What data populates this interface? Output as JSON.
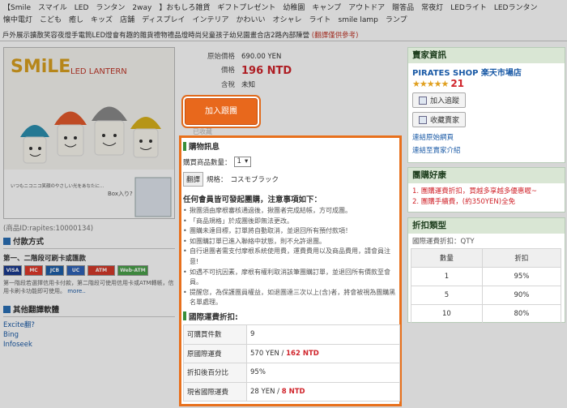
{
  "tags": [
    "【Smile",
    "スマイル",
    "LED",
    "ランタン",
    "2way",
    "】おもしろ雑貨",
    "ギフトプレゼント",
    "幼稚園",
    "キャンプ",
    "アウトドア",
    "贈答品",
    "常夜灯",
    "LEDライト",
    "LEDランタン",
    "懐中電灯",
    "こども",
    "癒し",
    "キッズ",
    "店舗",
    "ディスプレイ",
    "インテリア",
    "かわいい",
    "オシャレ",
    "ライト",
    "smile lamp",
    "ランプ"
  ],
  "title": "戶外展示擴散笑容夜燈手電筒LED燈會有趣的雜貨禮物禮品燈時尚兒童孩子幼兒園畫合店2路內部陳營",
  "title_note": "(翻譯僅供參考)",
  "product_image": {
    "brand": "SMiLE",
    "subtitle": "LED LANTERN",
    "caption": "いつもニコニコ笑顔のやさしい光をあなたに…",
    "box_label": "Box入り?"
  },
  "product_id": "(商品ID:rapites:10000134)",
  "payment": {
    "header": "付款方式",
    "line": "第一、二階段可刷卡或匯款",
    "cards": [
      "VISA",
      "MC",
      "JCB",
      "UC",
      "ATM",
      "Web-ATM"
    ],
    "note": "第一階段若選擇信用卡付款，第二階段可使用信用卡或ATM轉帳，信用卡刷卡功能即可使用。",
    "more": "more.."
  },
  "translator": {
    "header": "其他翻譯軟體",
    "links": [
      "Excite翻?",
      "Bing",
      "Infoseek"
    ]
  },
  "price": {
    "orig_label": "原始價格",
    "orig_value": "690.00 YEN",
    "price_label": "價格",
    "price_value": "196 NTD",
    "tax_label": "含稅",
    "tax_value": "未知"
  },
  "add_to_cart": "加入跟團",
  "added_link": "已收藏",
  "purchase": {
    "header": "購物訊息",
    "qty_label": "購買商品數量：",
    "qty_value": "1",
    "translate_btn": "翻譯",
    "spec_label": "規格：",
    "spec_value": "コスモブラック",
    "notice_title": "任何會員皆可發起團購，注意事項如下：",
    "rules": [
      "揪團須由摩根審核通過後，揪團者完成結帳，方可成團。",
      "「商品規格」於成團後即無法更改。",
      "團購未達目標，訂單將自動取消，並退回所有預付款項！",
      "如團購訂單已進入聯絡中狀態，則不允許退團。",
      "自行退團者需支付摩根系統使用費，運費費用以及商品費用，請會員注意!",
      "如遇不可抗因素，摩根有權利取消該筆團購訂單，並退回所有價款至會員。",
      "提醒您，為保護團員權益，如退團達三次以上(含)者，將會被視為團購黑名單處理。"
    ],
    "fee_header": "國際運費折扣:",
    "fees": [
      {
        "k": "可購買件數",
        "v": "9",
        "red": ""
      },
      {
        "k": "原國際運費",
        "v": "570 YEN / ",
        "red": "162 NTD"
      },
      {
        "k": "折扣後百分比",
        "v": "95%",
        "red": ""
      },
      {
        "k": "現省國際運費",
        "v": "28 YEN / ",
        "red": "8 NTD"
      }
    ]
  },
  "seller": {
    "header": "賣家資訊",
    "shop": "PIRATES SHOP 楽天市場店",
    "rating_count": "21",
    "rating_stars": 4.5,
    "follow_btn": "加入追蹤",
    "fav_btn": "收藏賣家",
    "link1": "連結原始網頁",
    "link2": "連結至賣家介紹"
  },
  "group": {
    "header": "團購好康",
    "line1": "1. 團購運費折扣，買越多享越多優惠喔~",
    "line2": "2. 團購手續費，(約350YEN)全免"
  },
  "discount": {
    "header": "折扣類型",
    "sub": "國際運費折扣：QTY",
    "cols": [
      "數量",
      "折扣"
    ],
    "rows": [
      [
        "1",
        "95%"
      ],
      [
        "5",
        "90%"
      ],
      [
        "10",
        "80%"
      ]
    ]
  },
  "colors": {
    "accent": "#e8701c",
    "price_red": "#d0242b",
    "green": "#3a8f3a",
    "link": "#1a5aa6"
  }
}
